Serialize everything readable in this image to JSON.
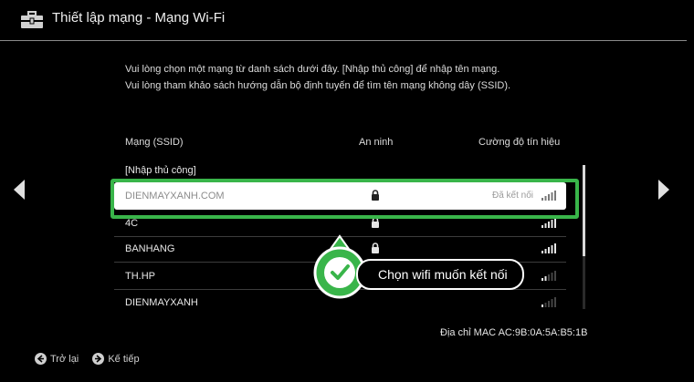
{
  "header": {
    "title": "Thiết lập mạng - Mạng Wi-Fi",
    "icon": "toolbox-icon"
  },
  "intro": {
    "line1": "Vui lòng chọn một mạng từ danh sách dưới đây. [Nhập thủ công] để nhập tên mạng.",
    "line2": "Vui lòng tham khảo sách hướng dẫn bộ định tuyến để tìm tên mạng không dây (SSID)."
  },
  "table": {
    "headers": {
      "ssid": "Mạng (SSID)",
      "security": "An ninh",
      "signal": "Cường độ tín hiệu"
    },
    "manual_entry": "[Nhập thủ công]",
    "rows": [
      {
        "ssid": "DIENMAYXANH.COM",
        "secured": true,
        "status": "Đã kết nối",
        "signal_bars": 4,
        "selected": true
      },
      {
        "ssid": "4C",
        "secured": true,
        "status": "",
        "signal_bars": 4,
        "selected": false
      },
      {
        "ssid": "BANHANG",
        "secured": true,
        "status": "",
        "signal_bars": 4,
        "selected": false
      },
      {
        "ssid": "TH.HP",
        "secured": false,
        "status": "",
        "signal_bars": 2,
        "selected": false
      },
      {
        "ssid": "DIENMAYXANH",
        "secured": false,
        "status": "",
        "signal_bars": 1,
        "selected": false
      }
    ]
  },
  "mac": "Địa chỉ MAC AC:9B:0A:5A:B5:1B",
  "footer": {
    "back": "Trở lại",
    "next": "Kế tiếp"
  },
  "callout": {
    "text": "Chọn wifi muốn kết nối",
    "icon": "check-icon"
  },
  "colors": {
    "highlight": "#39b54a",
    "background": "#000000"
  }
}
